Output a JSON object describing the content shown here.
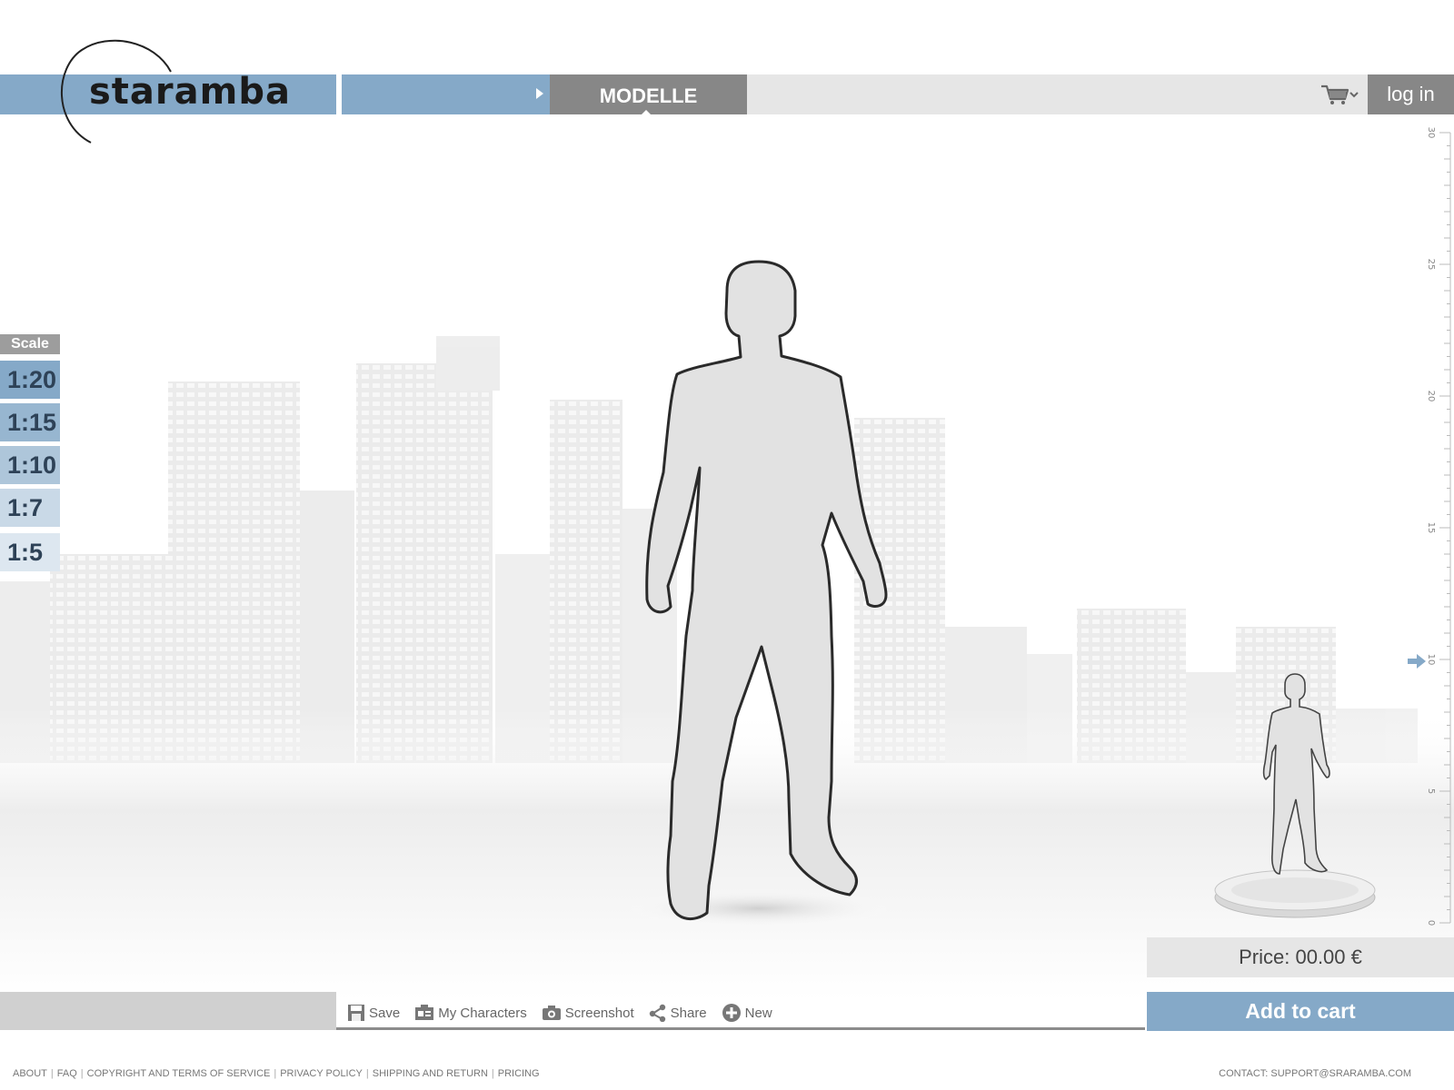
{
  "header": {
    "logo_text": "staramba",
    "nav_tab": "MODELLE",
    "login_label": "log in",
    "cart_icon": "shopping-cart-icon"
  },
  "scale": {
    "title": "Scale",
    "options": [
      "1:20",
      "1:15",
      "1:10",
      "1:7",
      "1:5"
    ],
    "selected": "1:20"
  },
  "ruler": {
    "labels": [
      "30",
      "25",
      "20",
      "15",
      "10",
      "5",
      "0"
    ],
    "marker_value": 10
  },
  "price": {
    "label": "Price: 00.00 €"
  },
  "add_to_cart_label": "Add to cart",
  "toolbar": {
    "items": [
      {
        "label": "Save",
        "icon": "save-icon"
      },
      {
        "label": "My Characters",
        "icon": "id-card-icon"
      },
      {
        "label": "Screenshot",
        "icon": "camera-icon"
      },
      {
        "label": "Share",
        "icon": "share-icon"
      },
      {
        "label": "New",
        "icon": "plus-circle-icon"
      }
    ]
  },
  "footer": {
    "links": [
      "ABOUT",
      "FAQ",
      "COPYRIGHT AND TERMS OF SERVICE",
      "PRIVACY POLICY",
      "SHIPPING AND RETURN",
      "PRICING"
    ],
    "contact": "CONTACT: SUPPORT@SRARAMBA.COM"
  },
  "colors": {
    "accent_blue": "#85a9c8",
    "dark_gray": "#878787",
    "light_gray": "#e6e6e6"
  }
}
